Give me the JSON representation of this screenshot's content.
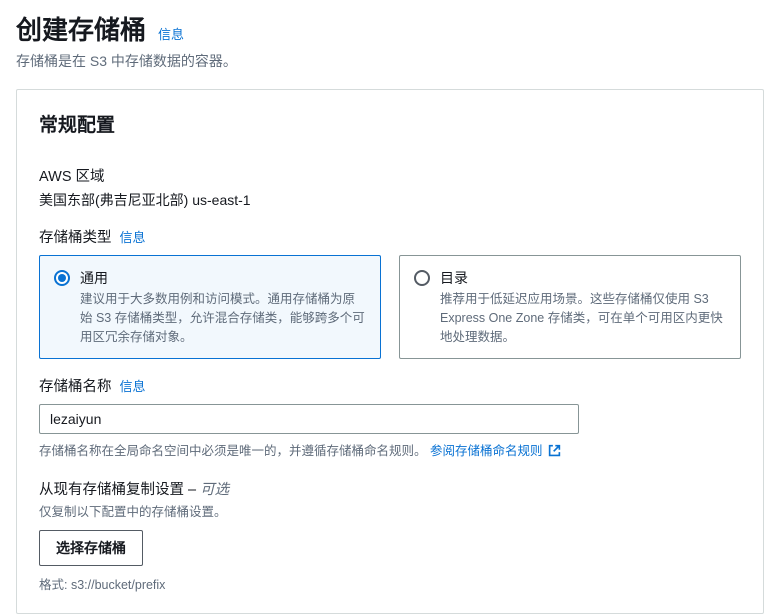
{
  "header": {
    "title": "创建存储桶",
    "info": "信息",
    "subtitle": "存储桶是在 S3 中存储数据的容器。"
  },
  "panel": {
    "title": "常规配置",
    "region": {
      "label": "AWS 区域",
      "value": "美国东部(弗吉尼亚北部) us-east-1"
    },
    "bucketType": {
      "label": "存储桶类型",
      "info": "信息",
      "options": [
        {
          "title": "通用",
          "desc": "建议用于大多数用例和访问模式。通用存储桶为原始 S3 存储桶类型，允许混合存储类，能够跨多个可用区冗余存储对象。",
          "selected": true
        },
        {
          "title": "目录",
          "desc": "推荐用于低延迟应用场景。这些存储桶仅使用 S3 Express One Zone 存储类，可在单个可用区内更快地处理数据。",
          "selected": false
        }
      ]
    },
    "bucketName": {
      "label": "存储桶名称",
      "info": "信息",
      "value": "lezaiyun",
      "hintPrefix": "存储桶名称在全局命名空间中必须是唯一的，并遵循存储桶命名规则。",
      "hintLink": "参阅存储桶命名规则"
    },
    "copy": {
      "heading": "从现有存储桶复制设置 –",
      "optional": "可选",
      "sub": "仅复制以下配置中的存储桶设置。",
      "button": "选择存储桶",
      "format": "格式: s3://bucket/prefix"
    }
  }
}
